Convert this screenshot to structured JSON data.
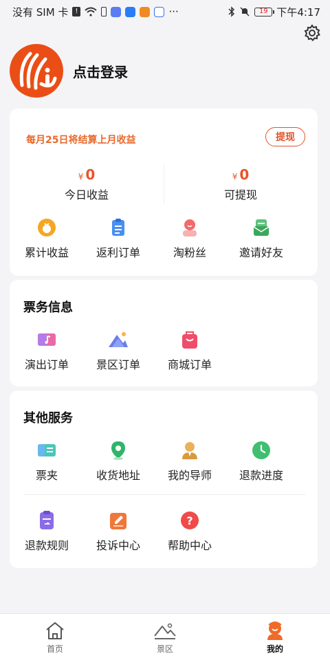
{
  "status_bar": {
    "carrier": "没有 SIM 卡",
    "time": "下午4:17",
    "battery": "19"
  },
  "header": {
    "settings_icon": "gear-icon",
    "login_label": "点击登录",
    "avatar_icon": "brand-logo"
  },
  "earnings": {
    "notice": "每月25日将结算上月收益",
    "withdraw_label": "提现",
    "currency": "¥",
    "today_amount": "0",
    "today_label": "今日收益",
    "withdrawable_amount": "0",
    "withdrawable_label": "可提现",
    "shortcuts": [
      {
        "label": "累计收益",
        "icon": "money-bag-icon"
      },
      {
        "label": "返利订单",
        "icon": "clipboard-icon"
      },
      {
        "label": "淘粉丝",
        "icon": "fan-user-icon"
      },
      {
        "label": "邀请好友",
        "icon": "invite-envelope-icon"
      }
    ]
  },
  "tickets": {
    "title": "票务信息",
    "items": [
      {
        "label": "演出订单",
        "icon": "music-ticket-icon"
      },
      {
        "label": "景区订单",
        "icon": "mountain-icon"
      },
      {
        "label": "商城订单",
        "icon": "shopping-bag-icon"
      }
    ]
  },
  "services": {
    "title": "其他服务",
    "row1": [
      {
        "label": "票夹",
        "icon": "ticket-folder-icon"
      },
      {
        "label": "收货地址",
        "icon": "location-pin-icon"
      },
      {
        "label": "我的导师",
        "icon": "mentor-icon"
      },
      {
        "label": "退款进度",
        "icon": "clock-icon"
      }
    ],
    "row2": [
      {
        "label": "退款规则",
        "icon": "refund-rules-icon"
      },
      {
        "label": "投诉中心",
        "icon": "edit-note-icon"
      },
      {
        "label": "帮助中心",
        "icon": "help-icon"
      }
    ]
  },
  "tabbar": {
    "tabs": [
      {
        "label": "首页",
        "icon": "home-icon"
      },
      {
        "label": "景区",
        "icon": "scenic-icon"
      },
      {
        "label": "我的",
        "icon": "profile-icon",
        "active": true
      }
    ]
  },
  "colors": {
    "accent": "#e8542a",
    "background": "#f4f4f6",
    "card": "#ffffff"
  }
}
